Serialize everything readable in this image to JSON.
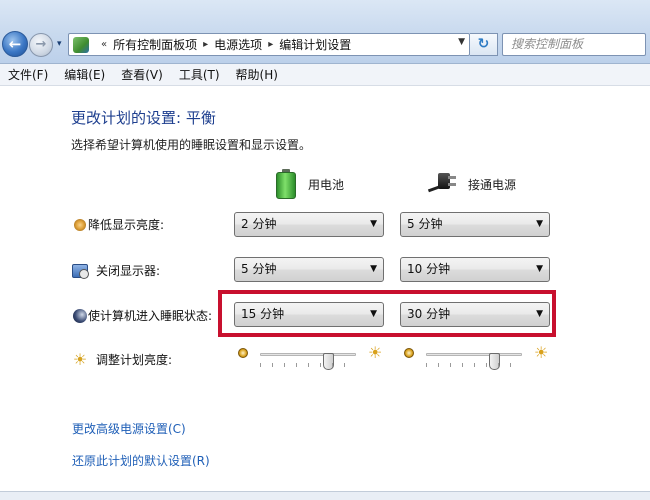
{
  "address_bar": {
    "breadcrumbs": [
      "所有控制面板项",
      "电源选项",
      "编辑计划设置"
    ],
    "search_placeholder": "搜索控制面板"
  },
  "menu": [
    "文件(F)",
    "编辑(E)",
    "查看(V)",
    "工具(T)",
    "帮助(H)"
  ],
  "page": {
    "title": "更改计划的设置: 平衡",
    "subtitle": "选择希望计算机使用的睡眠设置和显示设置。"
  },
  "columns": {
    "battery": "用电池",
    "plugged_in": "接通电源"
  },
  "rows": [
    {
      "label": "降低显示亮度:",
      "icon": "dim-display-icon",
      "battery": "2 分钟",
      "plugged_in": "5 分钟"
    },
    {
      "label": "关闭显示器:",
      "icon": "monitor-off-icon",
      "battery": "5 分钟",
      "plugged_in": "10 分钟"
    },
    {
      "label": "使计算机进入睡眠状态:",
      "icon": "sleep-moon-icon",
      "battery": "15 分钟",
      "plugged_in": "30 分钟"
    }
  ],
  "brightness": {
    "label": "调整计划亮度:",
    "battery_level": 0.75,
    "plugged_in_level": 0.75
  },
  "links": {
    "advanced": "更改高级电源设置(C)",
    "restore": "还原此计划的默认设置(R)"
  },
  "colors": {
    "title_blue": "#1e3f8f",
    "link_blue": "#1f5fb7",
    "highlight_red": "#c8102e"
  }
}
